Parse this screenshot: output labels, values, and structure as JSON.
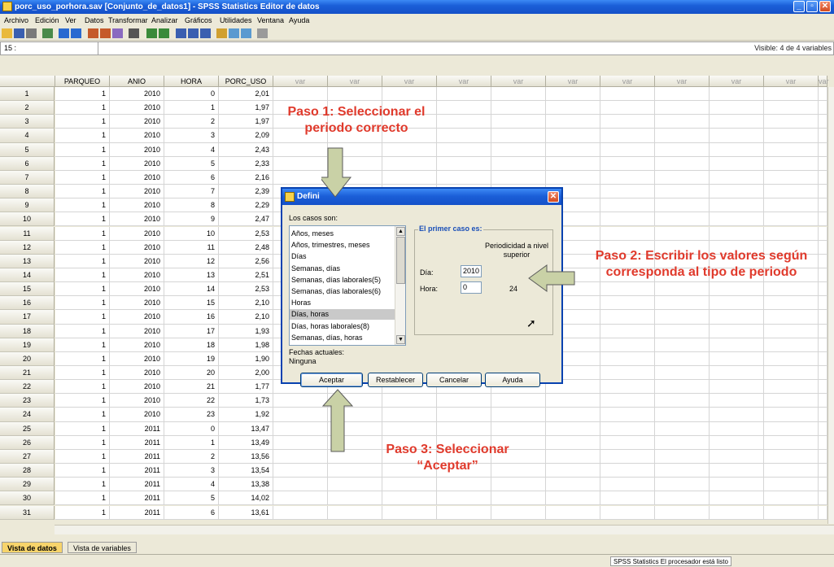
{
  "window": {
    "title": "porc_uso_porhora.sav [Conjunto_de_datos1] - SPSS Statistics Editor de datos"
  },
  "menu": [
    "Archivo",
    "Edición",
    "Ver",
    "Datos",
    "Transformar",
    "Analizar",
    "Gráficos",
    "Utilidades",
    "Ventana",
    "Ayuda"
  ],
  "cellbar": {
    "ref": "15 :",
    "visible": "Visible: 4 de 4 variables"
  },
  "columns": [
    "PARQUEO",
    "ANIO",
    "HORA",
    "PORC_USO",
    "var",
    "var",
    "var",
    "var",
    "var",
    "var",
    "var",
    "var",
    "var",
    "var",
    "var"
  ],
  "rows": [
    [
      "1",
      "1",
      "2010",
      "0",
      "2,01"
    ],
    [
      "2",
      "1",
      "2010",
      "1",
      "1,97"
    ],
    [
      "3",
      "1",
      "2010",
      "2",
      "1,97"
    ],
    [
      "4",
      "1",
      "2010",
      "3",
      "2,09"
    ],
    [
      "5",
      "1",
      "2010",
      "4",
      "2,43"
    ],
    [
      "6",
      "1",
      "2010",
      "5",
      "2,33"
    ],
    [
      "7",
      "1",
      "2010",
      "6",
      "2,16"
    ],
    [
      "8",
      "1",
      "2010",
      "7",
      "2,39"
    ],
    [
      "9",
      "1",
      "2010",
      "8",
      "2,29"
    ],
    [
      "10",
      "1",
      "2010",
      "9",
      "2,47"
    ],
    [
      "11",
      "1",
      "2010",
      "10",
      "2,53"
    ],
    [
      "12",
      "1",
      "2010",
      "11",
      "2,48"
    ],
    [
      "13",
      "1",
      "2010",
      "12",
      "2,56"
    ],
    [
      "14",
      "1",
      "2010",
      "13",
      "2,51"
    ],
    [
      "15",
      "1",
      "2010",
      "14",
      "2,53"
    ],
    [
      "16",
      "1",
      "2010",
      "15",
      "2,10"
    ],
    [
      "17",
      "1",
      "2010",
      "16",
      "2,10"
    ],
    [
      "18",
      "1",
      "2010",
      "17",
      "1,93"
    ],
    [
      "19",
      "1",
      "2010",
      "18",
      "1,98"
    ],
    [
      "20",
      "1",
      "2010",
      "19",
      "1,90"
    ],
    [
      "21",
      "1",
      "2010",
      "20",
      "2,00"
    ],
    [
      "22",
      "1",
      "2010",
      "21",
      "1,77"
    ],
    [
      "23",
      "1",
      "2010",
      "22",
      "1,73"
    ],
    [
      "24",
      "1",
      "2010",
      "23",
      "1,92"
    ],
    [
      "25",
      "1",
      "2011",
      "0",
      "13,47"
    ],
    [
      "26",
      "1",
      "2011",
      "1",
      "13,49"
    ],
    [
      "27",
      "1",
      "2011",
      "2",
      "13,56"
    ],
    [
      "28",
      "1",
      "2011",
      "3",
      "13,54"
    ],
    [
      "29",
      "1",
      "2011",
      "4",
      "13,38"
    ],
    [
      "30",
      "1",
      "2011",
      "5",
      "14,02"
    ],
    [
      "31",
      "1",
      "2011",
      "6",
      "13,61"
    ]
  ],
  "tabs": {
    "data_view": "Vista de datos",
    "variable_view": "Vista de variables"
  },
  "status": "SPSS Statistics  El procesador está listo",
  "dialog": {
    "title": "Defini",
    "cases_label": "Los casos son:",
    "list_items": [
      "Años, meses",
      "Años, trimestres, meses",
      "Días",
      "Semanas, días",
      "Semanas, días laborales(5)",
      "Semanas, días laborales(6)",
      "Horas",
      "Días, horas",
      "Días, horas laborales(8)",
      "Semanas, días, horas"
    ],
    "selected_item": "Días, horas",
    "first_case_label": "El primer caso es:",
    "periodicity_label": "Periodicidad a nivel superior",
    "day_label": "Día:",
    "day_value": "2010",
    "hour_label": "Hora:",
    "hour_value": "0",
    "hour_periodicity": "24",
    "current_dates_label": "Fechas actuales:",
    "current_dates_value": "Ninguna",
    "buttons": {
      "ok": "Aceptar",
      "reset": "Restablecer",
      "cancel": "Cancelar",
      "help": "Ayuda"
    }
  },
  "annotations": {
    "step1": "Paso 1: Seleccionar el periodo correcto",
    "step2": "Paso 2: Escribir los valores según corresponda al tipo de periodo",
    "step3": "Paso 3: Seleccionar “Aceptar”"
  },
  "colors": {
    "annotation": "#e03a2c",
    "titlebar": "#1b5fd8",
    "arrow": "#c9d1a6"
  }
}
